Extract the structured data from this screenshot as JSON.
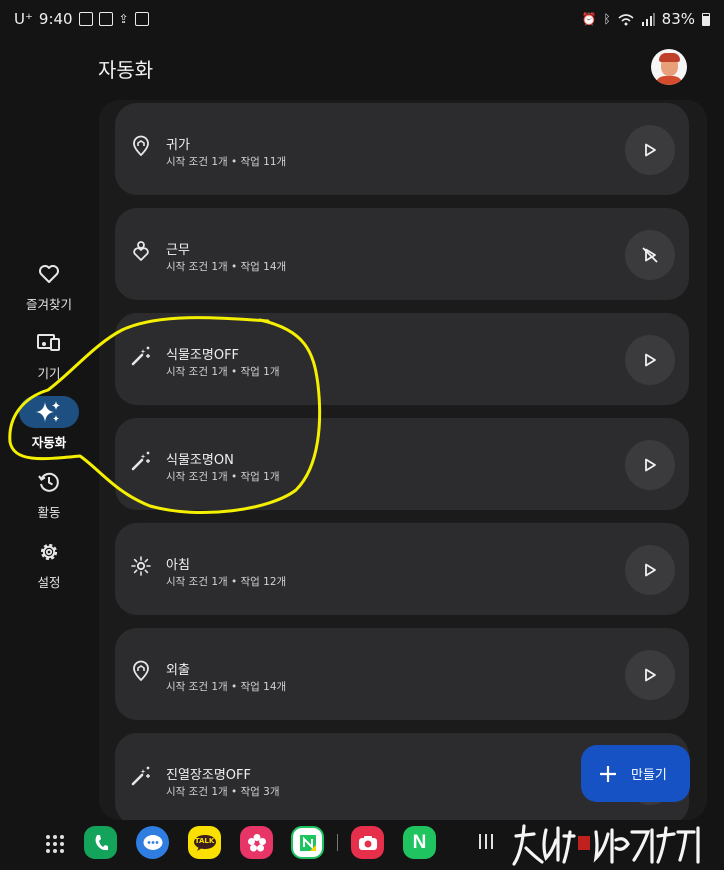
{
  "status_bar": {
    "carrier": "U⁺",
    "time": "9:40",
    "battery": "83%",
    "icons": [
      "screenshot-icon",
      "gallery-icon",
      "wireless-icon",
      "edit-icon",
      "alarm-icon",
      "bluetooth-icon",
      "wifi-icon",
      "signal-icon",
      "battery-icon"
    ]
  },
  "header": {
    "title": "자동화"
  },
  "nav": {
    "items": [
      {
        "label": "즐겨찾기",
        "icon": "heart-icon"
      },
      {
        "label": "기기",
        "icon": "devices-icon"
      },
      {
        "label": "자동화",
        "icon": "sparkle-icon",
        "active": true
      },
      {
        "label": "활동",
        "icon": "history-icon"
      },
      {
        "label": "설정",
        "icon": "gear-icon"
      }
    ]
  },
  "routines": [
    {
      "name": "귀가",
      "detail": "시작 조건 1개 • 작업 11개",
      "icon": "location-home-icon",
      "action": "play"
    },
    {
      "name": "근무",
      "detail": "시작 조건 1개 • 작업 14개",
      "icon": "person-pin-icon",
      "action": "play-disabled"
    },
    {
      "name": "식물조명OFF",
      "detail": "시작 조건 1개 • 작업 1개",
      "icon": "magic-wand-icon",
      "action": "play"
    },
    {
      "name": "식물조명ON",
      "detail": "시작 조건 1개 • 작업 1개",
      "icon": "magic-wand-icon",
      "action": "play"
    },
    {
      "name": "아침",
      "detail": "시작 조건 1개 • 작업 12개",
      "icon": "sun-icon",
      "action": "play"
    },
    {
      "name": "외출",
      "detail": "시작 조건 1개 • 작업 14개",
      "icon": "location-home-icon",
      "action": "play"
    },
    {
      "name": "진열장조명OFF",
      "detail": "시작 조건 1개 • 작업 3개",
      "icon": "magic-wand-icon",
      "action": "play"
    }
  ],
  "fab": {
    "label": "만들기"
  },
  "dock": {
    "apps": [
      "phone-app",
      "messages-app",
      "kakaotalk-app",
      "flower-app",
      "naver-note-app",
      "camera-app",
      "naver-app"
    ],
    "kakao_label": "TALK",
    "naver_label": "N"
  },
  "colors": {
    "background": "#141414",
    "card": "#2c2c2e",
    "nav_active": "#1d4f80",
    "fab": "#1652c4",
    "annotation": "#f4f000"
  }
}
